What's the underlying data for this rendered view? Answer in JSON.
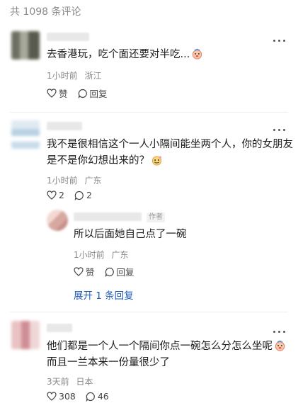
{
  "header": {
    "count_label": "共 1098 条评论"
  },
  "comments": [
    {
      "text": "去香港玩，吃个面还要对半吃...",
      "time": "1小时前",
      "location": "浙江",
      "like_label": "赞",
      "reply_label": "回复"
    },
    {
      "text_line1": "我不是很相信这个一人小隔间能坐两个人，你的女朋友",
      "text_line2": "是不是你幻想出来的？",
      "time": "1小时前",
      "location": "广东",
      "like_count": "2",
      "reply_count": "2",
      "reply": {
        "author_tag": "作者",
        "text": "所以后面她自己点了一碗",
        "time": "1小时前",
        "location": "广东",
        "like_label": "赞",
        "reply_label": "回复"
      },
      "expand_label": "展开 1 条回复"
    },
    {
      "text_line1": "他们都是一个人一个隔间你点一碗怎么分怎么坐呢",
      "text_line2": "而且一兰本来一份量很少了",
      "time": "3天前",
      "location": "日本",
      "like_count": "308",
      "reply_count": "46"
    }
  ],
  "colors": {
    "link": "#1f5db8",
    "meta": "#8a8a8a",
    "divider": "#eeeeee"
  },
  "icons": [
    "heart-icon",
    "comment-bubble-icon",
    "more-icon",
    "emoji-icon"
  ]
}
